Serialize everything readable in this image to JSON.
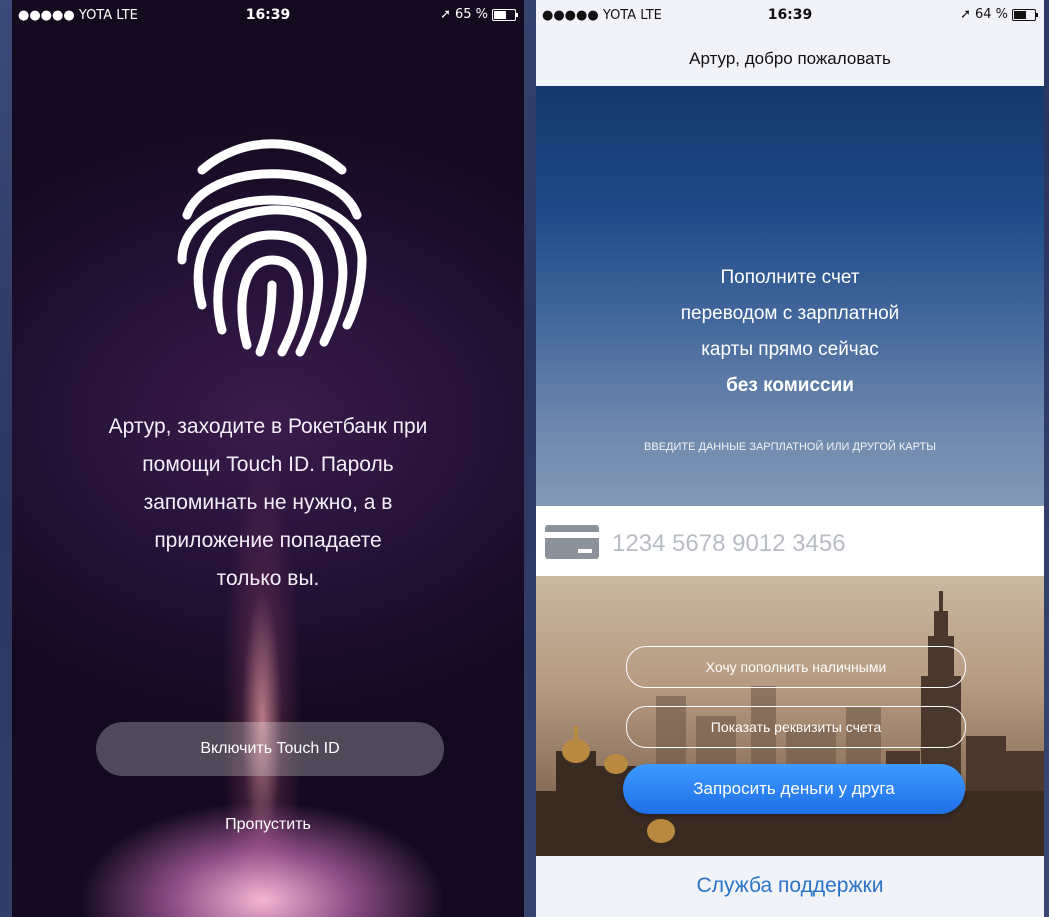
{
  "left_screen": {
    "status": {
      "carrier": "●●●●● YOTA  LTE",
      "time": "16:39",
      "battery": "65 %",
      "battery_level": 0.65
    },
    "icon": "fingerprint-icon",
    "message_lines": [
      "Артур, заходите в Рокетбанк при",
      "помощи Touch ID. Пароль",
      "запоминать не нужно, а в",
      "приложение попадаете",
      "только вы."
    ],
    "enable_button": "Включить Touch ID",
    "skip_link": "Пропустить"
  },
  "right_screen": {
    "status": {
      "carrier": "●●●●● YOTA  LTE",
      "time": "16:39",
      "battery": "64 %",
      "battery_level": 0.64
    },
    "header_title": "Артур, добро пожаловать",
    "hero": {
      "lines": [
        "Пополните счет",
        "переводом с зарплатной",
        "карты прямо сейчас"
      ],
      "bold_line": "без комиссии",
      "caption": "ВВЕДИТЕ ДАННЫЕ ЗАРПЛАТНОЙ ИЛИ ДРУГОЙ КАРТЫ"
    },
    "card_input": {
      "icon": "credit-card-icon",
      "placeholder": "1234 5678 9012 3456",
      "value": ""
    },
    "buttons": {
      "cash": "Хочу пополнить наличными",
      "requisites": "Показать реквизиты счета",
      "request_money": "Запросить деньги у друга"
    },
    "support_link": "Служба поддержки",
    "colors": {
      "primary_button": "#2a82f5",
      "support_link": "#2a73c8",
      "hero_top": "#15376d"
    }
  }
}
